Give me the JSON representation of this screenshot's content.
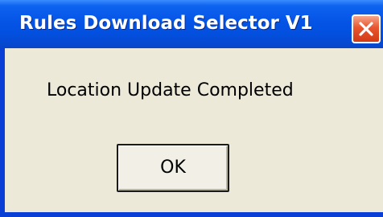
{
  "window": {
    "title": "Rules Download Selector V1",
    "close_icon": "close-x-icon"
  },
  "dialog": {
    "message": "Location Update Completed",
    "ok_label": "OK"
  },
  "colors": {
    "titlebar": "#0554e6",
    "window_body": "#ece9d8",
    "close_button": "#e8552e"
  }
}
